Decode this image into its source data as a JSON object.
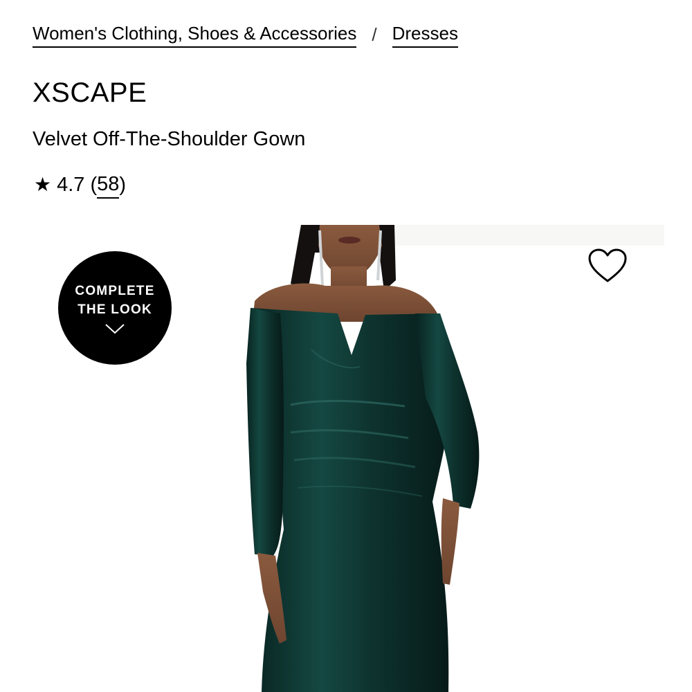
{
  "breadcrumb": {
    "items": [
      {
        "label": "Women's Clothing, Shoes & Accessories"
      },
      {
        "label": "Dresses"
      }
    ],
    "separator": "/"
  },
  "product": {
    "brand": "XSCAPE",
    "name": "Velvet Off-The-Shoulder Gown",
    "rating": {
      "star": "★",
      "value": "4.7",
      "open_paren": "(",
      "count": "58",
      "close_paren": ")"
    }
  },
  "complete_the_look": {
    "line1": "COMPLETE",
    "line2": "THE LOOK",
    "icon": "chevron-down-icon"
  },
  "favorite": {
    "icon": "heart-outline-icon"
  },
  "image": {
    "subject": "model wearing dark green velvet off-the-shoulder gown",
    "dress_color": "#0f2f2b"
  }
}
